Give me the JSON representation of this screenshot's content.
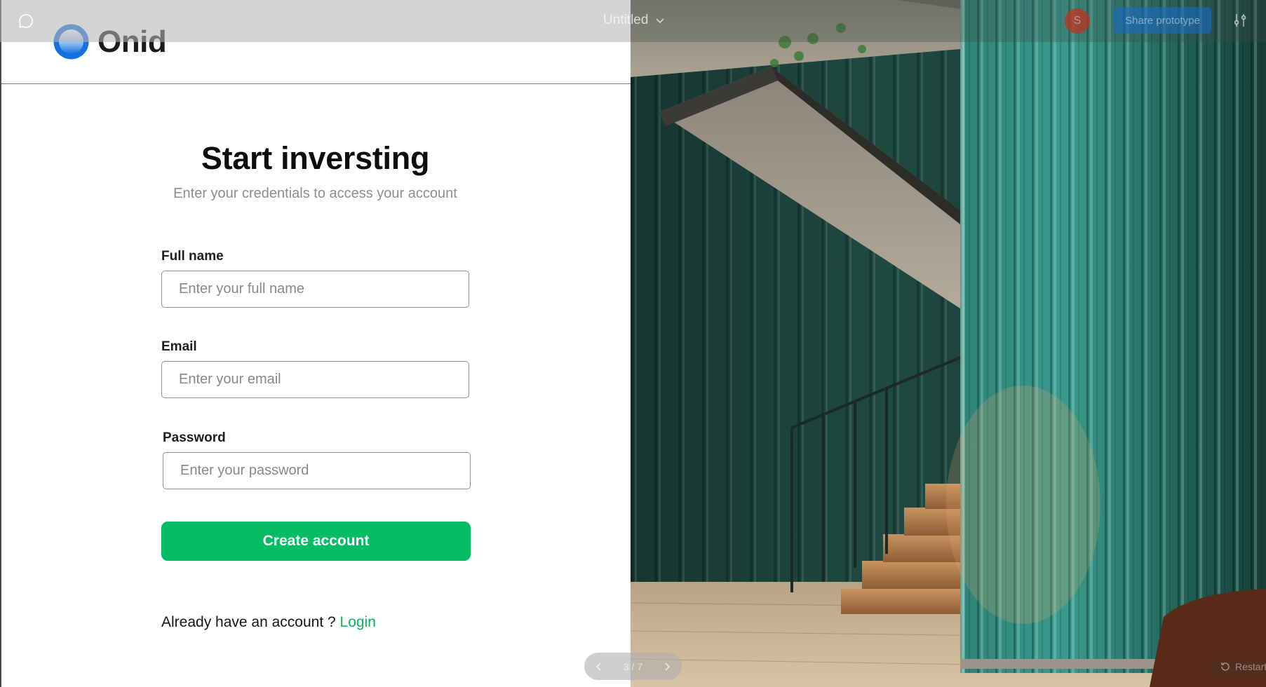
{
  "brand": {
    "name": "Onid",
    "accent_color": "#1570e0",
    "cta_color": "#04bc63"
  },
  "form": {
    "title": "Start inversting",
    "subtitle": "Enter your credentials to access your account",
    "fields": {
      "full_name": {
        "label": "Full name",
        "placeholder": "Enter your full name"
      },
      "email": {
        "label": "Email",
        "placeholder": "Enter your email"
      },
      "password": {
        "label": "Password",
        "placeholder": "Enter your password"
      }
    },
    "submit_label": "Create account",
    "login_prompt": "Already have an account ?",
    "login_link": "Login"
  },
  "viewer": {
    "document_title": "Untitled",
    "avatar_initial": "S",
    "share_label": "Share prototype",
    "page_counter": "3 / 7",
    "restart_label": "Restart"
  },
  "icons": {
    "comment": "comment-icon",
    "chevron": "chevron-down-icon",
    "settings": "sliders-icon",
    "prev": "chevron-left-icon",
    "next": "chevron-right-icon",
    "restart": "restart-icon"
  }
}
